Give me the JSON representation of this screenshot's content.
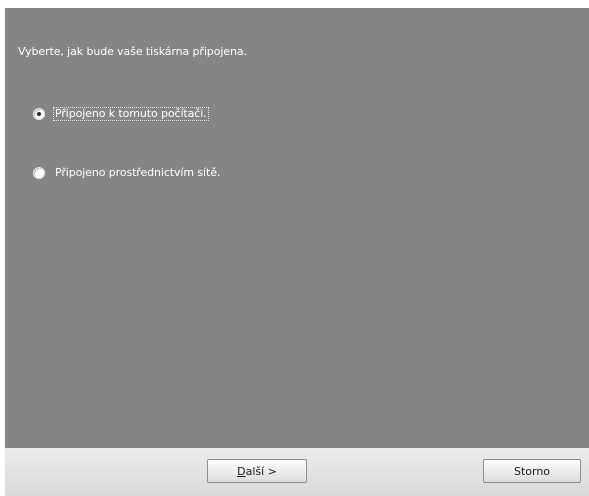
{
  "prompt": "Vyberte, jak bude vaše tiskárna připojena.",
  "options": [
    {
      "label": "Připojeno k tomuto počítači.",
      "selected": true
    },
    {
      "label": "Připojeno prostřednictvím sítě.",
      "selected": false
    }
  ],
  "buttons": {
    "next_mnemonic": "D",
    "next_rest": "alší >",
    "cancel": "Storno"
  }
}
